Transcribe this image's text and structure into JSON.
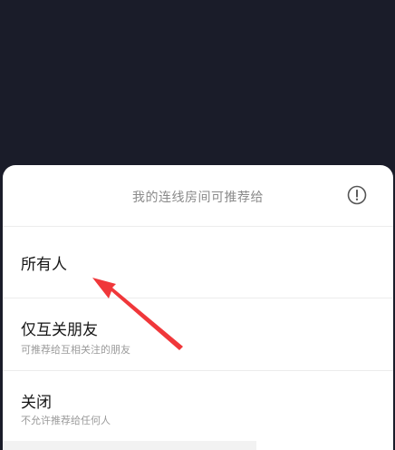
{
  "sheet": {
    "title": "我的连线房间可推荐给",
    "info_icon": "info-circle-icon",
    "options": [
      {
        "label": "所有人",
        "description": ""
      },
      {
        "label": "仅互关朋友",
        "description": "可推荐给互相关注的朋友"
      },
      {
        "label": "关闭",
        "description": "不允许推荐给任何人"
      }
    ]
  },
  "annotation": {
    "arrow_color": "#f0373a"
  }
}
